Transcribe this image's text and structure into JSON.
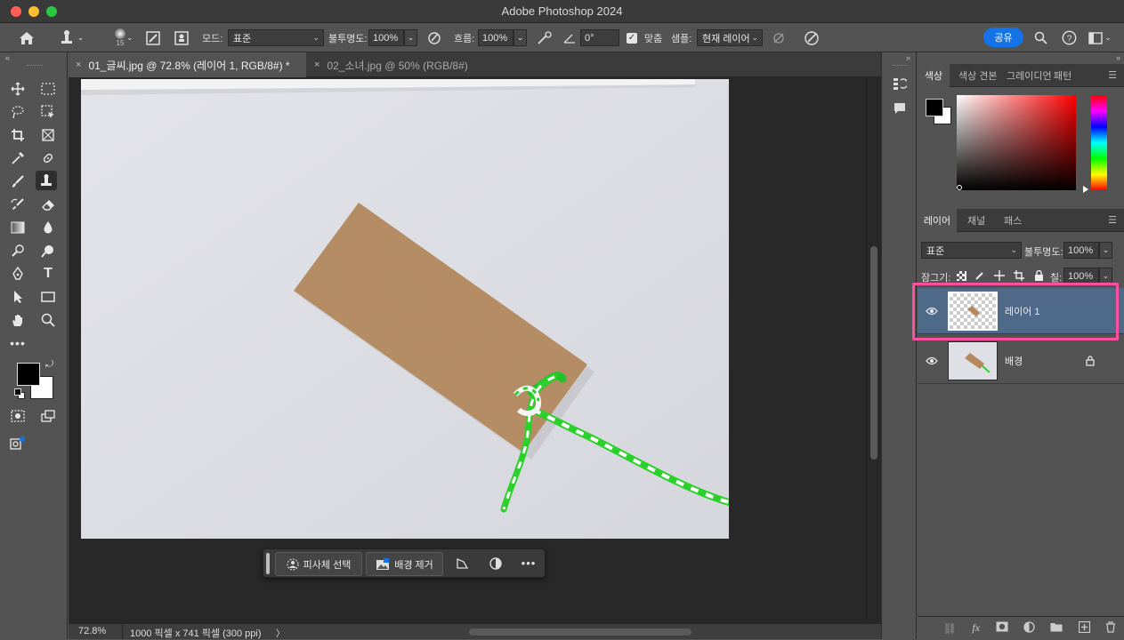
{
  "window": {
    "title": "Adobe Photoshop 2024"
  },
  "colors": {
    "accent": "#1473e6",
    "highlight": "#ff4fa0",
    "selected_layer": "#4e6a88",
    "close": "#ff5f57",
    "minimize": "#febc2e",
    "zoom": "#28c840"
  },
  "options_bar": {
    "brush_size": "15",
    "mode_label": "모드:",
    "mode_value": "표준",
    "opacity_label": "불투명도:",
    "opacity_value": "100%",
    "flow_label": "흐름:",
    "flow_value": "100%",
    "angle_value": "0°",
    "aligned_label": "맞춤",
    "sample_label": "샘플:",
    "sample_value": "현재 레이어",
    "share_label": "공유"
  },
  "tabs": [
    {
      "label": "01_글씨.jpg @ 72.8% (레이어 1, RGB/8#) *",
      "close": "×"
    },
    {
      "label": "02_소녀.jpg @ 50% (RGB/8#)",
      "close": "×"
    }
  ],
  "status": {
    "zoom": "72.8%",
    "info": "1000 픽셀 x 741 픽셀 (300 ppi)",
    "arrow": "〉"
  },
  "contextual_taskbar": {
    "select_subject": "피사체 선택",
    "remove_background": "배경 제거"
  },
  "color_panel": {
    "tabs": [
      "색상",
      "색상 견본",
      "그레이디언",
      "패턴"
    ]
  },
  "layers_panel": {
    "tabs": [
      "레이어",
      "채널",
      "패스"
    ],
    "blend_mode": "표준",
    "opacity_label": "불투명도:",
    "opacity_value": "100%",
    "lock_label": "잠그기:",
    "fill_label": "칠:",
    "fill_value": "100%",
    "layers": [
      {
        "name": "레이어 1",
        "selected": true,
        "visible": true,
        "locked": false
      },
      {
        "name": "배경",
        "selected": false,
        "visible": true,
        "locked": true
      }
    ]
  }
}
